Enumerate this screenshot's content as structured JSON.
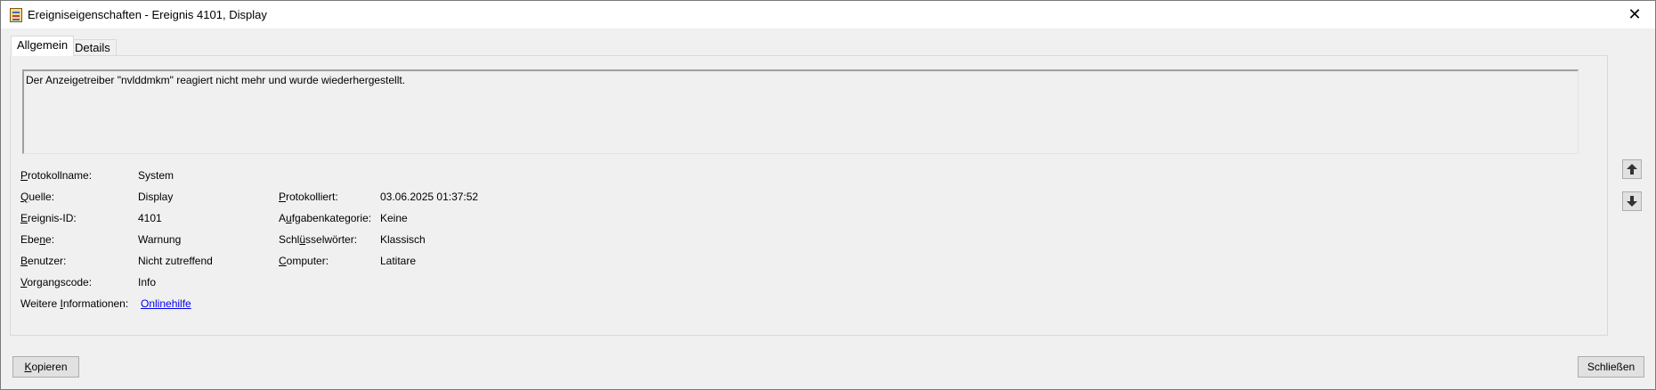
{
  "window": {
    "title": "Ereigniseigenschaften - Ereignis 4101, Display",
    "close_symbol": "✕"
  },
  "tabs": [
    {
      "label": "Allgemein",
      "active": true
    },
    {
      "label": "Details",
      "active": false
    }
  ],
  "message": "Der Anzeigetreiber \"nvlddmkm\" reagiert nicht mehr und wurde wiederhergestellt.",
  "fields_left": [
    {
      "pre": "",
      "key": "P",
      "post": "rotokollname:",
      "value": "System"
    },
    {
      "pre": "",
      "key": "Q",
      "post": "uelle:",
      "value": "Display"
    },
    {
      "pre": "",
      "key": "E",
      "post": "reignis-ID:",
      "value": "4101"
    },
    {
      "pre": "Ebe",
      "key": "n",
      "post": "e:",
      "value": "Warnung"
    },
    {
      "pre": "",
      "key": "B",
      "post": "enutzer:",
      "value": "Nicht zutreffend"
    },
    {
      "pre": "",
      "key": "V",
      "post": "organgscode:",
      "value": "Info"
    },
    {
      "pre": "Weitere ",
      "key": "I",
      "post": "nformationen:",
      "value": "Onlinehilfe"
    }
  ],
  "fields_right": [
    {
      "pre": "",
      "key": "P",
      "post": "rotokolliert:",
      "value": "03.06.2025 01:37:52"
    },
    {
      "pre": "A",
      "key": "u",
      "post": "fgabenkategorie:",
      "value": "Keine"
    },
    {
      "pre": "Schl",
      "key": "ü",
      "post": "sselwörter:",
      "value": "Klassisch"
    },
    {
      "pre": "",
      "key": "C",
      "post": "omputer:",
      "value": "Latitare"
    }
  ],
  "nav": {
    "up_icon": "arrow-up",
    "down_icon": "arrow-down"
  },
  "buttons": {
    "copy": {
      "key": "K",
      "rest": "opieren"
    },
    "close": {
      "label": "Schließen"
    }
  }
}
